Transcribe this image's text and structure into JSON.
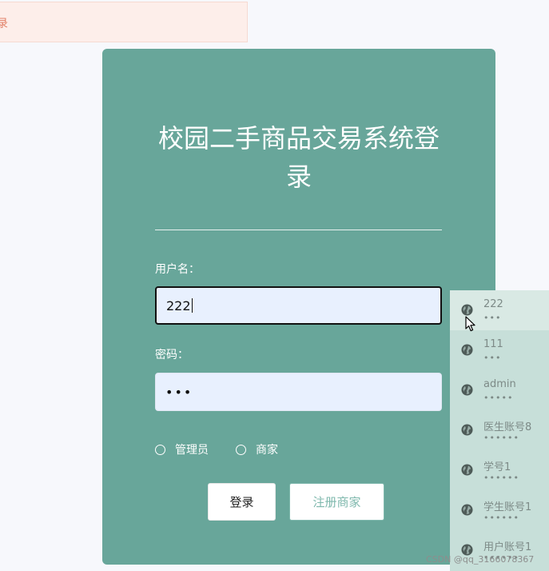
{
  "notice": {
    "text": "录"
  },
  "login": {
    "title": "校园二手商品交易系统登录",
    "username_label": "用户名：",
    "username_value": "222",
    "password_label": "密码：",
    "password_value": "•••",
    "roles": [
      {
        "label": "管理员"
      },
      {
        "label": "商家"
      }
    ],
    "login_button": "登录",
    "register_button": "注册商家"
  },
  "autofill": {
    "items": [
      {
        "name": "222",
        "password": "•••"
      },
      {
        "name": "111",
        "password": "•••"
      },
      {
        "name": "admin",
        "password": "•••••"
      },
      {
        "name": "医生账号8",
        "password": "••••••"
      },
      {
        "name": "学号1",
        "password": "••••••"
      },
      {
        "name": "学生账号1",
        "password": "••••••"
      },
      {
        "name": "用户账号1",
        "password": "••••••"
      }
    ]
  },
  "watermark": {
    "text": "CSDN @qq_3166078367"
  },
  "icons": {
    "account": "globe-icon",
    "pointer": "mouse-cursor-icon"
  },
  "colors": {
    "card": "#68a69a",
    "input": "#e8f0fe",
    "dropdown": "#c7dfd9",
    "toast_bg": "#fdeeea",
    "toast_text": "#e2836b"
  }
}
